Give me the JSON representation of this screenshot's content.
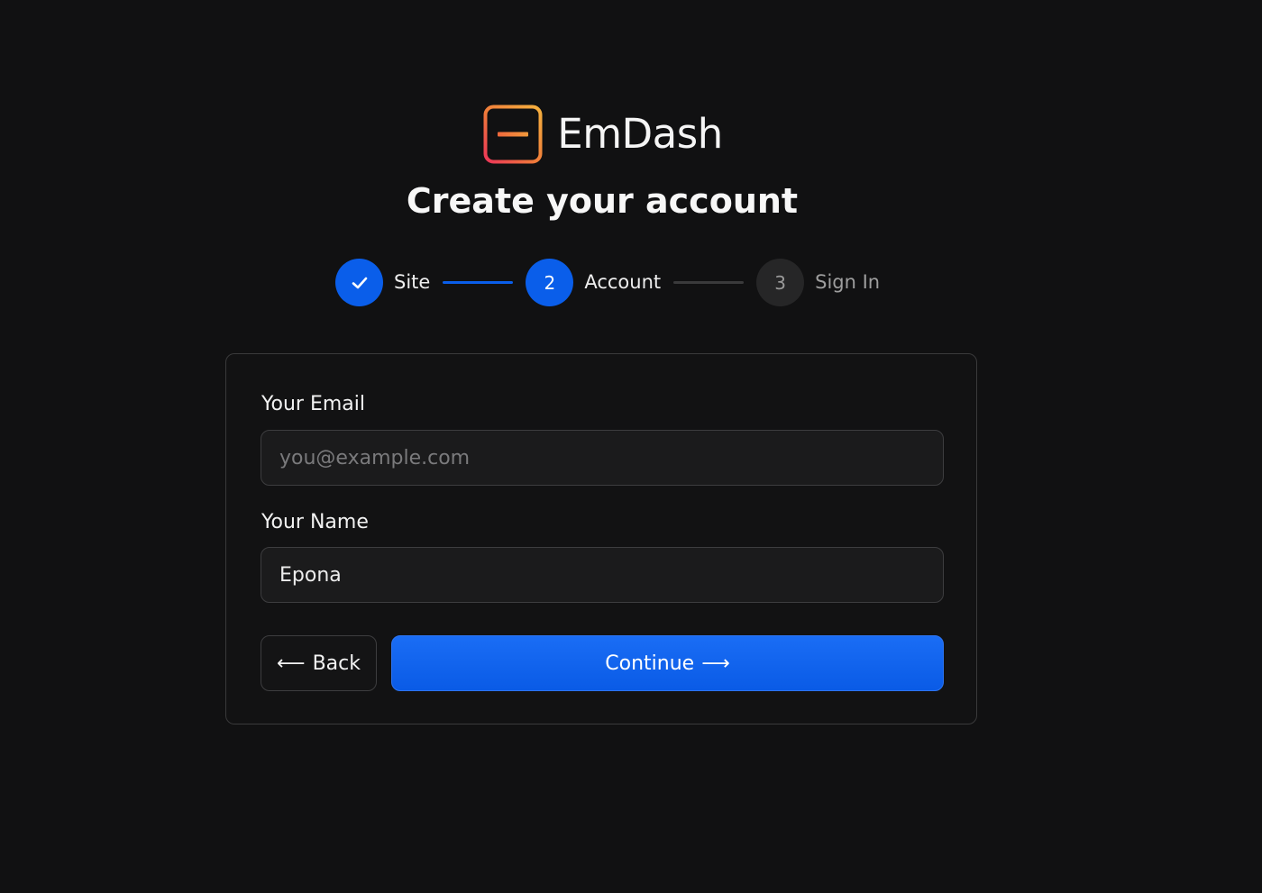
{
  "brand": {
    "name": "EmDash",
    "logo_colors": [
      "#f2a93b",
      "#ee3b54"
    ]
  },
  "page_title": "Create your account",
  "stepper": {
    "steps": [
      {
        "number": "1",
        "label": "Site",
        "status": "done",
        "icon": "check-icon"
      },
      {
        "number": "2",
        "label": "Account",
        "status": "active"
      },
      {
        "number": "3",
        "label": "Sign In",
        "status": "todo"
      }
    ],
    "accent_color": "#0a5eea"
  },
  "form": {
    "email": {
      "label": "Your Email",
      "value": "",
      "placeholder": "you@example.com"
    },
    "name": {
      "label": "Your Name",
      "value": "Epona",
      "placeholder": ""
    },
    "back_button": {
      "label": "Back",
      "icon": "arrow-left-icon",
      "arrow": "⟵"
    },
    "continue_button": {
      "label": "Continue",
      "icon": "arrow-right-icon",
      "arrow": "⟶"
    }
  }
}
